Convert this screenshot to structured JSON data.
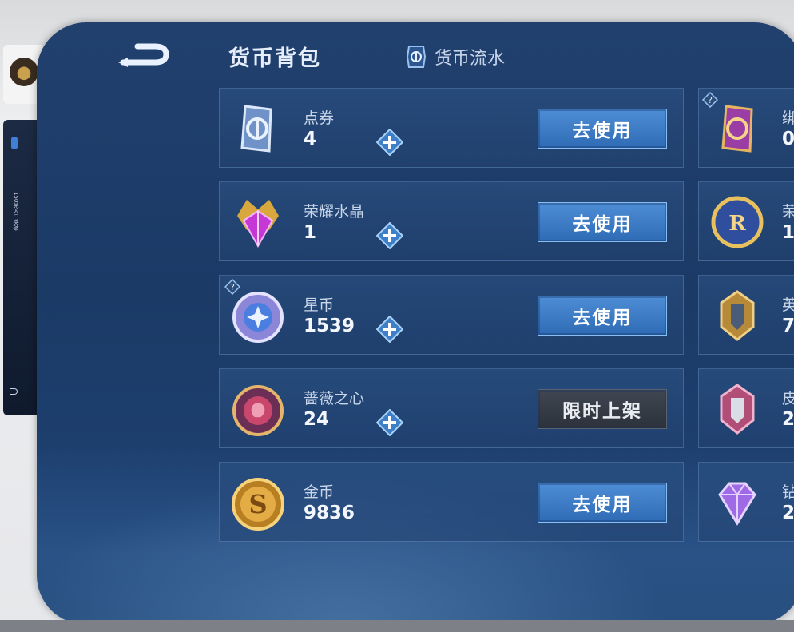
{
  "header": {
    "title": "货币背包",
    "flow_label": "货币流水"
  },
  "side": {
    "vertical_text": "150兑入门突破"
  },
  "currencies": [
    {
      "name": "点券",
      "value": "4",
      "action": "去使用",
      "action_style": "primary"
    },
    {
      "name": "荣耀水晶",
      "value": "1",
      "action": "去使用",
      "action_style": "primary"
    },
    {
      "name": "星币",
      "value": "1539",
      "action": "去使用",
      "action_style": "primary"
    },
    {
      "name": "蔷薇之心",
      "value": "24",
      "action": "限时上架",
      "action_style": "disabled"
    },
    {
      "name": "金币",
      "value": "9836",
      "action": "去使用",
      "action_style": "primary"
    }
  ],
  "right_currencies": [
    {
      "name": "绑",
      "value": "0"
    },
    {
      "name": "荣",
      "value": "1"
    },
    {
      "name": "英",
      "value": "7"
    },
    {
      "name": "皮",
      "value": "2"
    },
    {
      "name": "钻",
      "value": "2"
    }
  ],
  "colors": {
    "panel": "#1e3d6a",
    "button_blue": "#3f7fcc",
    "button_dark": "#353b45"
  },
  "icons": [
    "back-arrow-icon",
    "flow-ticket-icon",
    "coupon-icon",
    "crystal-icon",
    "star-coin-icon",
    "rose-heart-icon",
    "gold-coin-icon",
    "plus-icon",
    "bind-coupon-icon",
    "honor-token-icon",
    "hero-fragment-icon",
    "skin-fragment-icon",
    "diamond-icon",
    "question-badge-icon"
  ]
}
